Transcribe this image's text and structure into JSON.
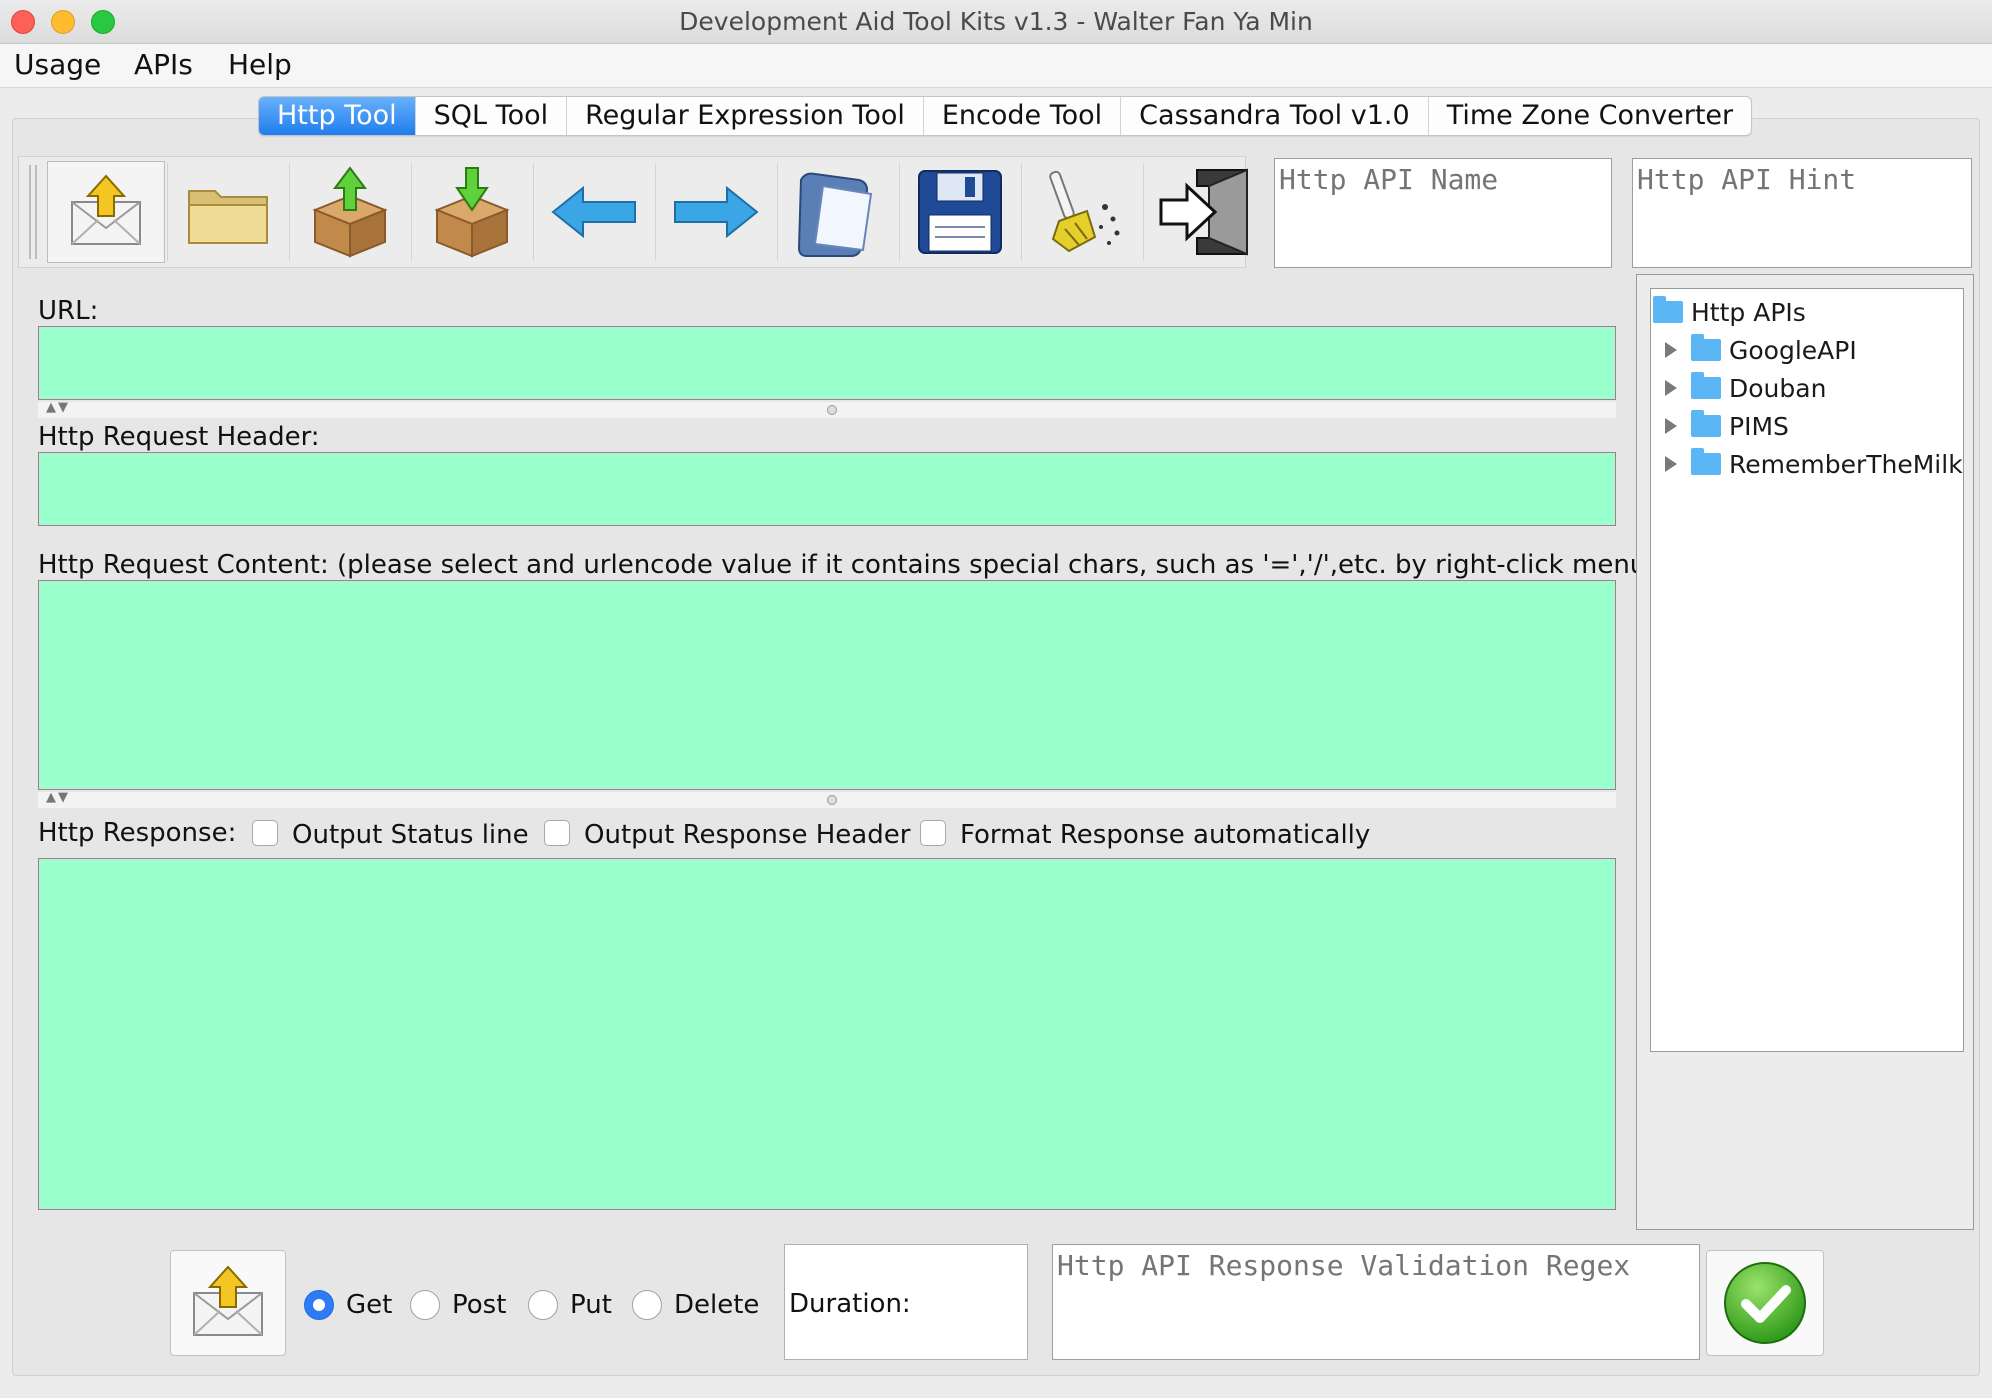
{
  "window": {
    "title": "Development Aid Tool Kits v1.3 - Walter Fan Ya Min"
  },
  "menu": [
    "Usage",
    "APIs",
    "Help"
  ],
  "tabs": [
    {
      "label": "Http Tool",
      "active": true
    },
    {
      "label": "SQL Tool",
      "active": false
    },
    {
      "label": "Regular Expression Tool",
      "active": false
    },
    {
      "label": "Encode Tool",
      "active": false
    },
    {
      "label": "Cassandra Tool v1.0",
      "active": false
    },
    {
      "label": "Time Zone Converter",
      "active": false
    }
  ],
  "toolbar": {
    "icons": [
      "send-mail-icon",
      "open-folder-icon",
      "upload-box-icon",
      "download-box-icon",
      "back-arrow-icon",
      "forward-arrow-icon",
      "open-file-icon",
      "save-disk-icon",
      "clean-broom-icon",
      "exit-door-icon"
    ]
  },
  "api": {
    "name_placeholder": "Http API Name",
    "hint_placeholder": "Http API Hint"
  },
  "fields": {
    "url_label": "URL:",
    "header_label": "Http Request Header:",
    "content_label": "Http Request Content: (please select and urlencode value if it contains special chars, such as '=','/',etc. by right-click menu)",
    "response_label": "Http Response:"
  },
  "options": [
    {
      "label": "Output Status line",
      "checked": false
    },
    {
      "label": "Output Response Header",
      "checked": false
    },
    {
      "label": "Format Response automatically",
      "checked": false
    }
  ],
  "tree": {
    "root": "Http APIs",
    "children": [
      "GoogleAPI",
      "Douban",
      "PIMS",
      "RememberTheMilk"
    ]
  },
  "bottom": {
    "methods": [
      "Get",
      "Post",
      "Put",
      "Delete"
    ],
    "selected_method": "Get",
    "duration_label": "Duration:",
    "validation_placeholder": "Http API Response Validation Regex"
  },
  "colors": {
    "field_green": "#99ffcc",
    "tab_active": "#1f7dee",
    "radio_on": "#2d7cf6"
  }
}
